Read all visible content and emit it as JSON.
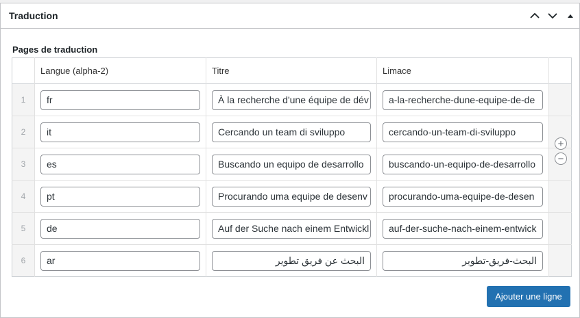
{
  "metabox": {
    "title": "Traduction"
  },
  "field": {
    "label": "Pages de traduction"
  },
  "table": {
    "headers": [
      "",
      "Langue (alpha-2)",
      "Titre",
      "Limace",
      ""
    ],
    "rows": [
      {
        "num": "1",
        "lang": "fr",
        "title": "À la recherche d'une équipe de dév",
        "slug": "a-la-recherche-dune-equipe-de-de"
      },
      {
        "num": "2",
        "lang": "it",
        "title": "Cercando un team di sviluppo",
        "slug": "cercando-un-team-di-sviluppo"
      },
      {
        "num": "3",
        "lang": "es",
        "title": "Buscando un equipo de desarrollo",
        "slug": "buscando-un-equipo-de-desarrollo"
      },
      {
        "num": "4",
        "lang": "pt",
        "title": "Procurando uma equipe de desenv",
        "slug": "procurando-uma-equipe-de-desen"
      },
      {
        "num": "5",
        "lang": "de",
        "title": "Auf der Suche nach einem Entwickl",
        "slug": "auf-der-suche-nach-einem-entwick"
      },
      {
        "num": "6",
        "lang": "ar",
        "title": "البحث عن فريق تطوير",
        "slug": "البحث-فريق-تطوير"
      }
    ]
  },
  "actions": {
    "add_row_label": "Ajouter une ligne",
    "add_icon": "plus-circle-icon",
    "remove_icon": "minus-circle-icon"
  },
  "colors": {
    "primary": "#2271b1",
    "border": "#c3c4c7"
  }
}
